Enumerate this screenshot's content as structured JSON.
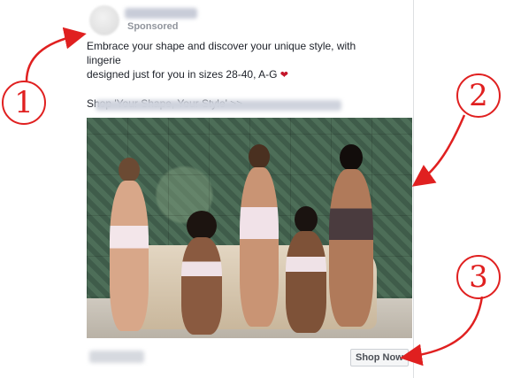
{
  "ad": {
    "sponsored_label": "Sponsored",
    "caption_line1": "Embrace your shape and discover your unique style, with lingerie",
    "caption_line2": "designed just for you in sizes 28-40, A-G",
    "heart_emoji": "❤",
    "shop_line": "Shop 'Your Shape, Your Style' >>",
    "cta_label": "Shop Now"
  },
  "callouts": [
    {
      "number": "1"
    },
    {
      "number": "2"
    },
    {
      "number": "3"
    }
  ],
  "colors": {
    "callout_red": "#e02020",
    "caption_text": "#1d2129",
    "sponsored_text": "#90949c"
  },
  "photo": {
    "description_icon": "photo-image"
  }
}
